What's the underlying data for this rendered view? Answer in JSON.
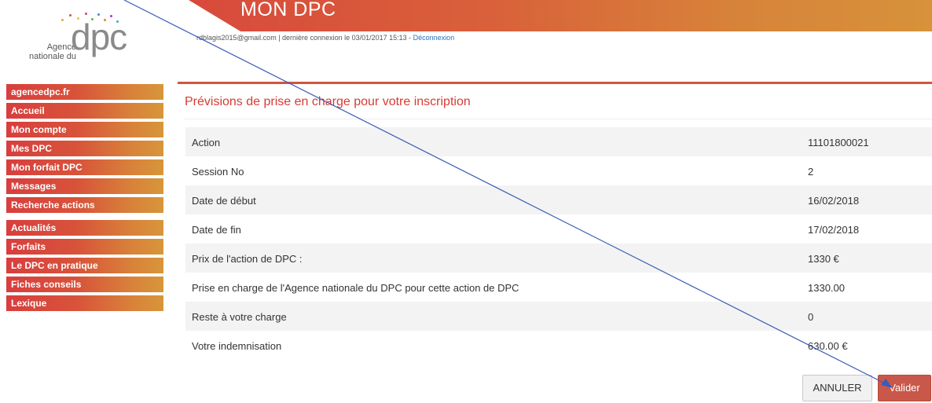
{
  "logo": {
    "line1": "Agence",
    "line2": "nationale du",
    "mark": "dpc"
  },
  "header": {
    "title": "MON DPC",
    "user_email": "rdblagis2015@gmail.com",
    "last_login_text": " | dernière connexion le 03/01/2017 15:13 - ",
    "logout_label": "Déconnexion"
  },
  "sidebar": {
    "items": [
      {
        "label": "agencedpc.fr"
      },
      {
        "label": "Accueil"
      },
      {
        "label": "Mon compte"
      },
      {
        "label": "Mes DPC"
      },
      {
        "label": "Mon forfait DPC"
      },
      {
        "label": "Messages"
      },
      {
        "label": "Recherche actions"
      },
      {
        "label": "Actualités"
      },
      {
        "label": "Forfaits"
      },
      {
        "label": "Le DPC en pratique"
      },
      {
        "label": "Fiches conseils"
      },
      {
        "label": "Lexique"
      }
    ]
  },
  "main": {
    "title": "Prévisions de prise en charge pour votre inscription",
    "rows": [
      {
        "label": "Action",
        "value": "11101800021"
      },
      {
        "label": "Session No",
        "value": "2"
      },
      {
        "label": "Date de début",
        "value": "16/02/2018"
      },
      {
        "label": "Date de fin",
        "value": "17/02/2018"
      },
      {
        "label": "Prix de l'action de DPC :",
        "value": "1330 €"
      },
      {
        "label": "Prise en charge de l'Agence nationale du DPC pour cette action de DPC",
        "value": "1330.00"
      },
      {
        "label": "Reste à votre charge",
        "value": "0"
      },
      {
        "label": "Votre indemnisation",
        "value": "630.00 €"
      }
    ],
    "cancel_label": "ANNULER",
    "submit_label": "Valider"
  },
  "colors": {
    "accent": "#d63c34",
    "banner_start": "#d84a3c",
    "banner_end": "#d7923a",
    "link": "#2a6fb5",
    "submit_bg": "#c9584a",
    "annotation_line": "#3b5bb8"
  }
}
